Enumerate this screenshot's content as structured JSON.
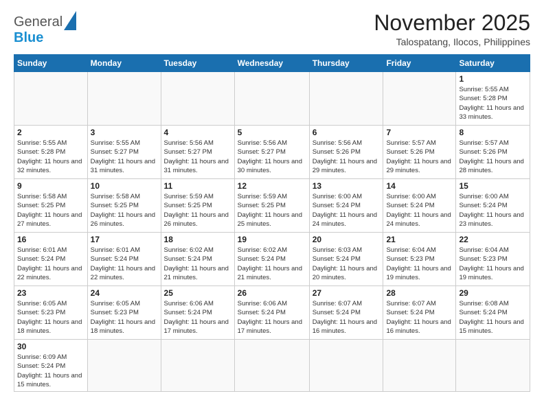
{
  "header": {
    "logo": {
      "general": "General",
      "blue": "Blue"
    },
    "title": "November 2025",
    "location": "Talospatang, Ilocos, Philippines"
  },
  "weekdays": [
    "Sunday",
    "Monday",
    "Tuesday",
    "Wednesday",
    "Thursday",
    "Friday",
    "Saturday"
  ],
  "days": {
    "d1": {
      "num": "1",
      "sunrise": "Sunrise: 5:55 AM",
      "sunset": "Sunset: 5:28 PM",
      "daylight": "Daylight: 11 hours and 33 minutes."
    },
    "d2": {
      "num": "2",
      "sunrise": "Sunrise: 5:55 AM",
      "sunset": "Sunset: 5:28 PM",
      "daylight": "Daylight: 11 hours and 32 minutes."
    },
    "d3": {
      "num": "3",
      "sunrise": "Sunrise: 5:55 AM",
      "sunset": "Sunset: 5:27 PM",
      "daylight": "Daylight: 11 hours and 31 minutes."
    },
    "d4": {
      "num": "4",
      "sunrise": "Sunrise: 5:56 AM",
      "sunset": "Sunset: 5:27 PM",
      "daylight": "Daylight: 11 hours and 31 minutes."
    },
    "d5": {
      "num": "5",
      "sunrise": "Sunrise: 5:56 AM",
      "sunset": "Sunset: 5:27 PM",
      "daylight": "Daylight: 11 hours and 30 minutes."
    },
    "d6": {
      "num": "6",
      "sunrise": "Sunrise: 5:56 AM",
      "sunset": "Sunset: 5:26 PM",
      "daylight": "Daylight: 11 hours and 29 minutes."
    },
    "d7": {
      "num": "7",
      "sunrise": "Sunrise: 5:57 AM",
      "sunset": "Sunset: 5:26 PM",
      "daylight": "Daylight: 11 hours and 29 minutes."
    },
    "d8": {
      "num": "8",
      "sunrise": "Sunrise: 5:57 AM",
      "sunset": "Sunset: 5:26 PM",
      "daylight": "Daylight: 11 hours and 28 minutes."
    },
    "d9": {
      "num": "9",
      "sunrise": "Sunrise: 5:58 AM",
      "sunset": "Sunset: 5:25 PM",
      "daylight": "Daylight: 11 hours and 27 minutes."
    },
    "d10": {
      "num": "10",
      "sunrise": "Sunrise: 5:58 AM",
      "sunset": "Sunset: 5:25 PM",
      "daylight": "Daylight: 11 hours and 26 minutes."
    },
    "d11": {
      "num": "11",
      "sunrise": "Sunrise: 5:59 AM",
      "sunset": "Sunset: 5:25 PM",
      "daylight": "Daylight: 11 hours and 26 minutes."
    },
    "d12": {
      "num": "12",
      "sunrise": "Sunrise: 5:59 AM",
      "sunset": "Sunset: 5:25 PM",
      "daylight": "Daylight: 11 hours and 25 minutes."
    },
    "d13": {
      "num": "13",
      "sunrise": "Sunrise: 6:00 AM",
      "sunset": "Sunset: 5:24 PM",
      "daylight": "Daylight: 11 hours and 24 minutes."
    },
    "d14": {
      "num": "14",
      "sunrise": "Sunrise: 6:00 AM",
      "sunset": "Sunset: 5:24 PM",
      "daylight": "Daylight: 11 hours and 24 minutes."
    },
    "d15": {
      "num": "15",
      "sunrise": "Sunrise: 6:00 AM",
      "sunset": "Sunset: 5:24 PM",
      "daylight": "Daylight: 11 hours and 23 minutes."
    },
    "d16": {
      "num": "16",
      "sunrise": "Sunrise: 6:01 AM",
      "sunset": "Sunset: 5:24 PM",
      "daylight": "Daylight: 11 hours and 22 minutes."
    },
    "d17": {
      "num": "17",
      "sunrise": "Sunrise: 6:01 AM",
      "sunset": "Sunset: 5:24 PM",
      "daylight": "Daylight: 11 hours and 22 minutes."
    },
    "d18": {
      "num": "18",
      "sunrise": "Sunrise: 6:02 AM",
      "sunset": "Sunset: 5:24 PM",
      "daylight": "Daylight: 11 hours and 21 minutes."
    },
    "d19": {
      "num": "19",
      "sunrise": "Sunrise: 6:02 AM",
      "sunset": "Sunset: 5:24 PM",
      "daylight": "Daylight: 11 hours and 21 minutes."
    },
    "d20": {
      "num": "20",
      "sunrise": "Sunrise: 6:03 AM",
      "sunset": "Sunset: 5:24 PM",
      "daylight": "Daylight: 11 hours and 20 minutes."
    },
    "d21": {
      "num": "21",
      "sunrise": "Sunrise: 6:04 AM",
      "sunset": "Sunset: 5:23 PM",
      "daylight": "Daylight: 11 hours and 19 minutes."
    },
    "d22": {
      "num": "22",
      "sunrise": "Sunrise: 6:04 AM",
      "sunset": "Sunset: 5:23 PM",
      "daylight": "Daylight: 11 hours and 19 minutes."
    },
    "d23": {
      "num": "23",
      "sunrise": "Sunrise: 6:05 AM",
      "sunset": "Sunset: 5:23 PM",
      "daylight": "Daylight: 11 hours and 18 minutes."
    },
    "d24": {
      "num": "24",
      "sunrise": "Sunrise: 6:05 AM",
      "sunset": "Sunset: 5:23 PM",
      "daylight": "Daylight: 11 hours and 18 minutes."
    },
    "d25": {
      "num": "25",
      "sunrise": "Sunrise: 6:06 AM",
      "sunset": "Sunset: 5:24 PM",
      "daylight": "Daylight: 11 hours and 17 minutes."
    },
    "d26": {
      "num": "26",
      "sunrise": "Sunrise: 6:06 AM",
      "sunset": "Sunset: 5:24 PM",
      "daylight": "Daylight: 11 hours and 17 minutes."
    },
    "d27": {
      "num": "27",
      "sunrise": "Sunrise: 6:07 AM",
      "sunset": "Sunset: 5:24 PM",
      "daylight": "Daylight: 11 hours and 16 minutes."
    },
    "d28": {
      "num": "28",
      "sunrise": "Sunrise: 6:07 AM",
      "sunset": "Sunset: 5:24 PM",
      "daylight": "Daylight: 11 hours and 16 minutes."
    },
    "d29": {
      "num": "29",
      "sunrise": "Sunrise: 6:08 AM",
      "sunset": "Sunset: 5:24 PM",
      "daylight": "Daylight: 11 hours and 15 minutes."
    },
    "d30": {
      "num": "30",
      "sunrise": "Sunrise: 6:09 AM",
      "sunset": "Sunset: 5:24 PM",
      "daylight": "Daylight: 11 hours and 15 minutes."
    }
  }
}
